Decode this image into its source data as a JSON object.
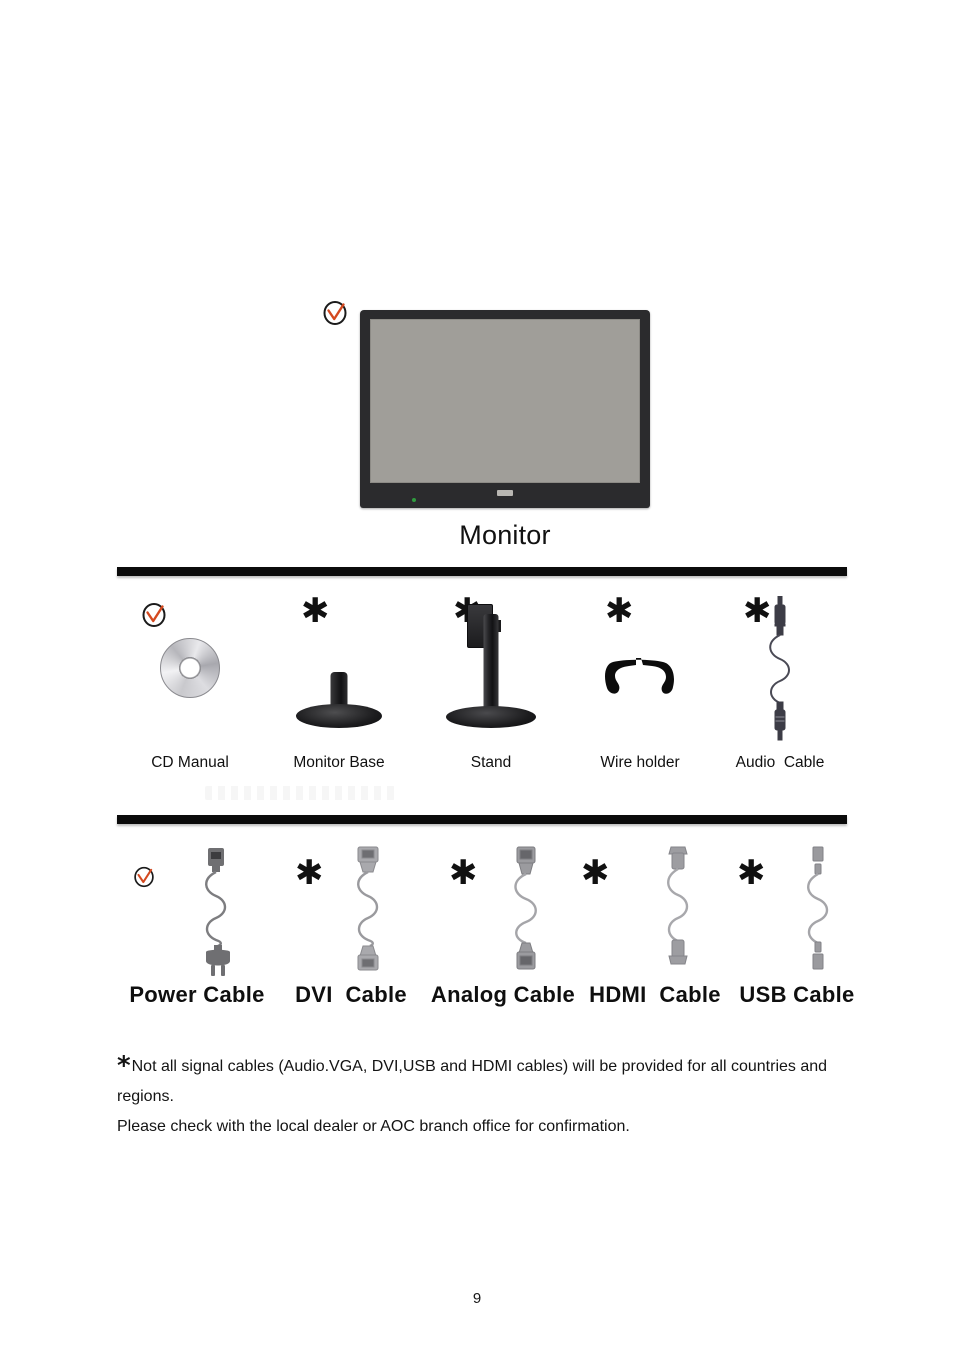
{
  "document": {
    "page_number": "9"
  },
  "monitor": {
    "caption": "Monitor",
    "marker_icon": "check-circle-icon",
    "screen_color": "#a09e99",
    "bezel_color": "#2b2b2d",
    "led_color": "#2f9b3e"
  },
  "accessories": {
    "items": [
      {
        "label": "CD Manual",
        "marker": "check-circle-icon",
        "icon": "cd-disc-icon"
      },
      {
        "label": "Monitor Base",
        "marker": "asterisk",
        "icon": "monitor-base-icon"
      },
      {
        "label": "Stand",
        "marker": "asterisk",
        "icon": "stand-icon"
      },
      {
        "label": "Wire holder",
        "marker": "asterisk",
        "icon": "wire-holder-icon"
      },
      {
        "label": "Audio  Cable",
        "marker": "asterisk",
        "icon": "audio-cable-icon"
      }
    ]
  },
  "cables": {
    "items": [
      {
        "label": "Power Cable",
        "marker": "check-circle-icon",
        "icon": "power-cable-icon"
      },
      {
        "label": "DVI  Cable",
        "marker": "asterisk",
        "icon": "dvi-cable-icon"
      },
      {
        "label": "Analog Cable",
        "marker": "asterisk",
        "icon": "vga-cable-icon"
      },
      {
        "label": "HDMI  Cable",
        "marker": "asterisk",
        "icon": "hdmi-cable-icon"
      },
      {
        "label": "USB Cable",
        "marker": "asterisk",
        "icon": "usb-cable-icon"
      }
    ]
  },
  "footnote": {
    "marker": "*",
    "line1": "Not all signal cables (Audio.VGA, DVI,USB and HDMI cables) will be provided for all countries and regions.",
    "line2": "Please check with the local dealer or AOC branch office for confirmation."
  },
  "markers": {
    "asterisk_glyph": "✱",
    "check_circle_ring_color": "#1b1b1b",
    "check_circle_tick_color": "#d4491f"
  }
}
